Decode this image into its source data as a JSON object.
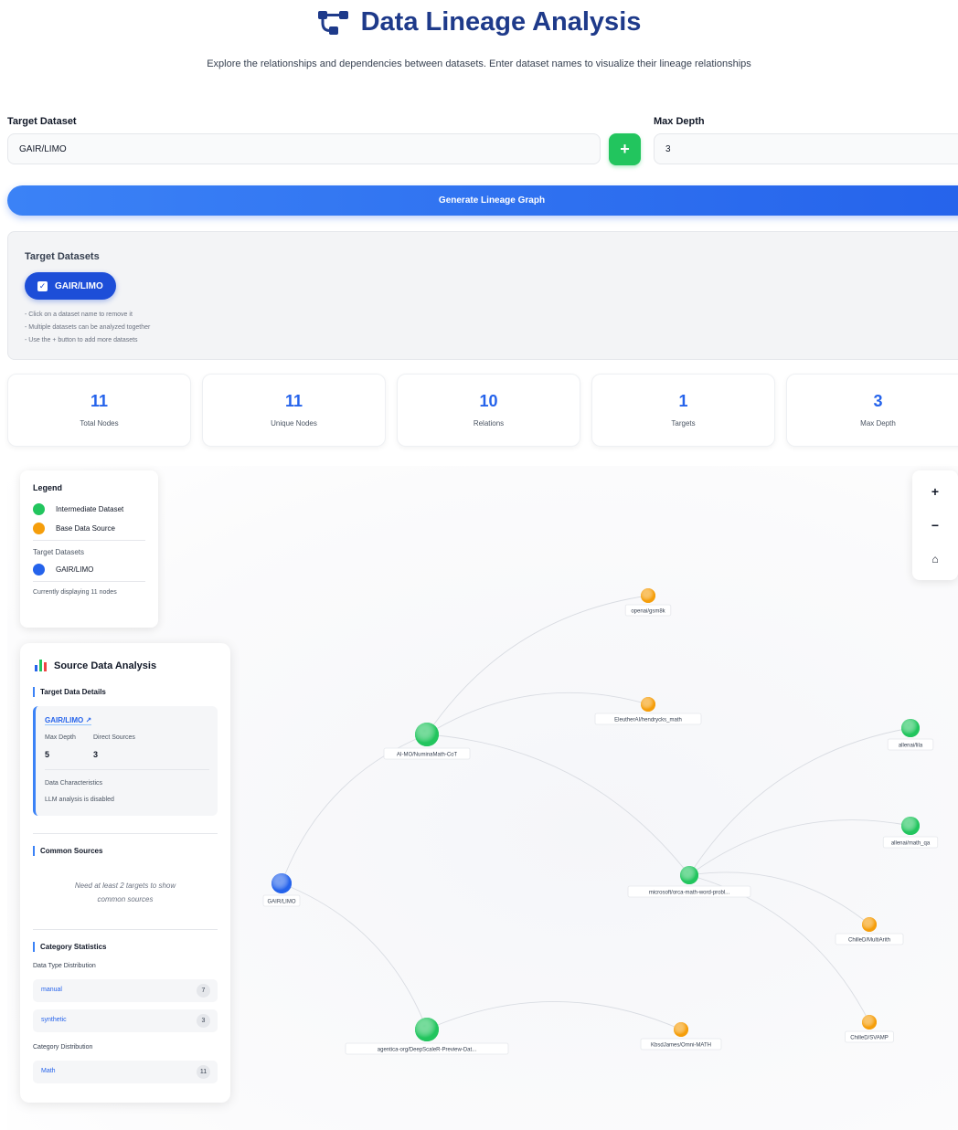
{
  "header": {
    "title": "Data Lineage Analysis",
    "subtitle": "Explore the relationships and dependencies between datasets. Enter dataset names to visualize their lineage relationships"
  },
  "form": {
    "target_label": "Target Dataset",
    "target_value": "GAIR/LIMO",
    "add_label": "+",
    "depth_label": "Max Depth",
    "depth_value": "3",
    "generate_label": "Generate Lineage Graph"
  },
  "targets": {
    "title": "Target Datasets",
    "chips": [
      "GAIR/LIMO"
    ],
    "hints": [
      "- Click on a dataset name to remove it",
      "- Multiple datasets can be analyzed together",
      "- Use the + button to add more datasets"
    ]
  },
  "stats": [
    {
      "value": "11",
      "label": "Total Nodes"
    },
    {
      "value": "11",
      "label": "Unique Nodes"
    },
    {
      "value": "10",
      "label": "Relations"
    },
    {
      "value": "1",
      "label": "Targets"
    },
    {
      "value": "3",
      "label": "Max Depth"
    }
  ],
  "legend": {
    "title": "Legend",
    "intermediate": "Intermediate Dataset",
    "base": "Base Data Source",
    "targets_title": "Target Datasets",
    "target_item": "GAIR/LIMO",
    "footer": "Currently displaying 11 nodes"
  },
  "zoom": {
    "in": "+",
    "out": "−",
    "home": "⌂"
  },
  "colors": {
    "intermediate": "#22c55e",
    "base": "#f59e0b",
    "target": "#2563eb",
    "accent": "#2563eb"
  },
  "analysis": {
    "title": "Source Data Analysis",
    "target_details": "Target Data Details",
    "target_name": "GAIR/LIMO ↗",
    "max_depth_key": "Max Depth",
    "max_depth_val": "5",
    "direct_sources_key": "Direct Sources",
    "direct_sources_val": "3",
    "characteristics_key": "Data Characteristics",
    "characteristics_val": "LLM analysis is disabled",
    "common_sources": "Common Sources",
    "common_msg_1": "Need at least 2 targets to show",
    "common_msg_2": "common sources",
    "category_stats": "Category Statistics",
    "data_type_dist": "Data Type Distribution",
    "data_types": [
      {
        "name": "manual",
        "count": "7"
      },
      {
        "name": "synthetic",
        "count": "3"
      }
    ],
    "category_dist": "Category Distribution",
    "categories": [
      {
        "name": "Math",
        "count": "11"
      }
    ]
  },
  "graph": {
    "nodes": [
      {
        "id": "limo",
        "label": "GAIR/LIMO",
        "kind": "target"
      },
      {
        "id": "numina",
        "label": "AI-MO/NuminaMath-CoT",
        "kind": "intermediate"
      },
      {
        "id": "deepscale",
        "label": "agentica-org/DeepScaleR-Preview-Dat...",
        "kind": "intermediate"
      },
      {
        "id": "orca",
        "label": "microsoft/orca-math-word-probl...",
        "kind": "intermediate"
      },
      {
        "id": "gsm8k",
        "label": "openai/gsm8k",
        "kind": "base"
      },
      {
        "id": "hendrycks",
        "label": "EleutherAI/hendrycks_math",
        "kind": "base"
      },
      {
        "id": "lila",
        "label": "allenai/lila",
        "kind": "intermediate"
      },
      {
        "id": "mathqa",
        "label": "allenai/math_qa",
        "kind": "intermediate"
      },
      {
        "id": "multiarith",
        "label": "ChilleD/MultiArith",
        "kind": "base"
      },
      {
        "id": "svamp",
        "label": "ChilleD/SVAMP",
        "kind": "base"
      },
      {
        "id": "omni",
        "label": "KbsdJames/Omni-MATH",
        "kind": "base"
      }
    ],
    "edges": [
      [
        "limo",
        "numina"
      ],
      [
        "limo",
        "deepscale"
      ],
      [
        "numina",
        "gsm8k"
      ],
      [
        "numina",
        "hendrycks"
      ],
      [
        "numina",
        "orca"
      ],
      [
        "orca",
        "lila"
      ],
      [
        "orca",
        "mathqa"
      ],
      [
        "orca",
        "multiarith"
      ],
      [
        "orca",
        "svamp"
      ],
      [
        "deepscale",
        "omni"
      ]
    ]
  }
}
